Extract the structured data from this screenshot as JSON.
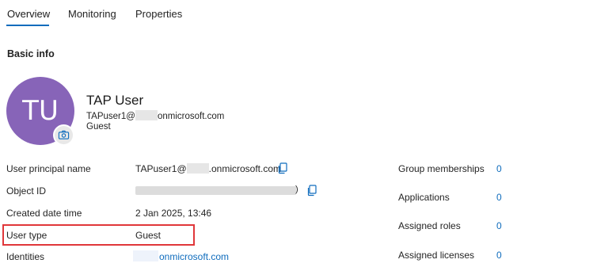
{
  "tabs": [
    {
      "label": "Overview"
    },
    {
      "label": "Monitoring"
    },
    {
      "label": "Properties"
    }
  ],
  "section_title": "Basic info",
  "profile": {
    "initials": "TU",
    "display_name": "TAP User",
    "upn_prefix": "TAPuser1@",
    "upn_suffix": "onmicrosoft.com",
    "user_type": "Guest"
  },
  "fields": {
    "upn": {
      "label": "User principal name",
      "value_prefix": "TAPuser1@",
      "value_suffix": ".onmicrosoft.com"
    },
    "object_id": {
      "label": "Object ID",
      "value_tail": ")"
    },
    "created": {
      "label": "Created date time",
      "value": "2 Jan 2025, 13:46"
    },
    "user_type": {
      "label": "User type",
      "value": "Guest"
    },
    "identities": {
      "label": "Identities",
      "value": "onmicrosoft.com"
    }
  },
  "stats": [
    {
      "label": "Group memberships",
      "value": "0"
    },
    {
      "label": "Applications",
      "value": "0"
    },
    {
      "label": "Assigned roles",
      "value": "0"
    },
    {
      "label": "Assigned licenses",
      "value": "0"
    }
  ],
  "colors": {
    "accent": "#0f6cbd",
    "avatar": "#8764b8",
    "highlight": "#e0373a"
  },
  "icons": {
    "camera": "camera-icon",
    "copy": "copy-icon"
  }
}
